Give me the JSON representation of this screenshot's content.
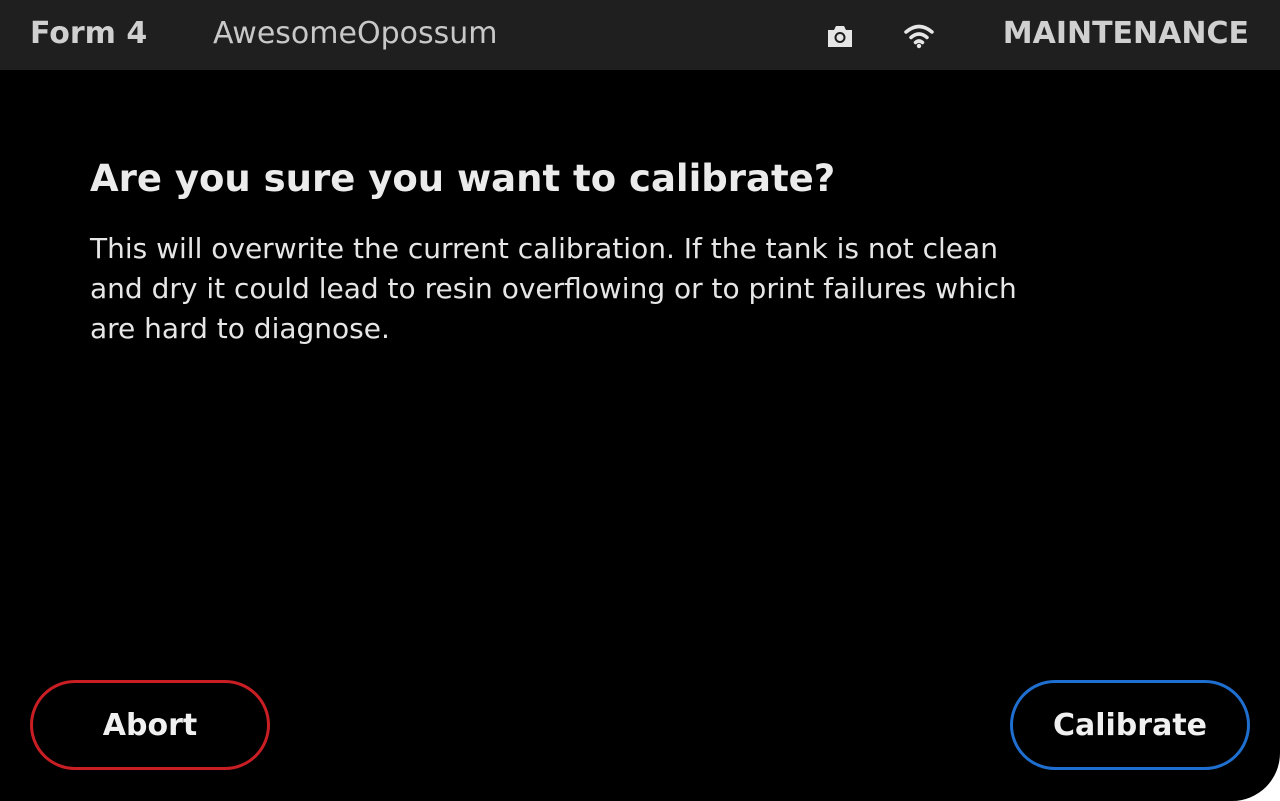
{
  "status_bar": {
    "printer_model": "Form 4",
    "printer_name": "AwesomeOpossum",
    "icons": [
      "camera-icon",
      "wifi-icon"
    ],
    "mode": "MAINTENANCE"
  },
  "dialog": {
    "title": "Are you sure you want to calibrate?",
    "message": "This will overwrite the current calibration. If the tank is not clean and dry it could lead to resin overflowing or to print failures which are hard to diagnose."
  },
  "actions": {
    "abort_label": "Abort",
    "calibrate_label": "Calibrate"
  },
  "colors": {
    "background": "#000000",
    "status_bar": "#1f1f1f",
    "abort_border": "#c81e24",
    "calibrate_border": "#1f6fd0"
  }
}
